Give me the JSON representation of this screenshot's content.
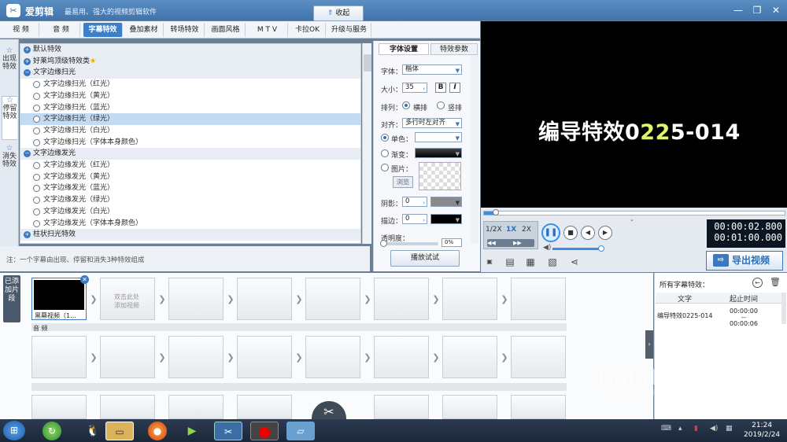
{
  "window": {
    "title": "爱剪辑",
    "slogan": "最易用、强大的视频剪辑软件",
    "logo_icon": "scissors-logo-icon"
  },
  "menu": {
    "tabs": [
      {
        "label": "视 频"
      },
      {
        "label": "音 频"
      },
      {
        "label": "字幕特效",
        "active": true
      },
      {
        "label": "叠加素材"
      },
      {
        "label": "转场特效"
      },
      {
        "label": "画面风格"
      },
      {
        "label": "M T V"
      },
      {
        "label": "卡拉OK"
      },
      {
        "label": "升级与服务"
      }
    ]
  },
  "side_tabs": [
    {
      "label": "出现特效"
    },
    {
      "label": "停留特效",
      "active": true
    },
    {
      "label": "消失特效"
    }
  ],
  "effect_list": [
    {
      "label": "默认特效",
      "type": "category"
    },
    {
      "label": "好莱坞顶级特效类",
      "type": "category",
      "star": "★"
    },
    {
      "label": "文字边缘扫光",
      "type": "category"
    },
    {
      "label": "文字边缘扫光（红光）",
      "type": "item"
    },
    {
      "label": "文字边缘扫光（黄光）",
      "type": "item"
    },
    {
      "label": "文字边缘扫光（蓝光）",
      "type": "item"
    },
    {
      "label": "文字边缘扫光（绿光）",
      "type": "item",
      "selected": true
    },
    {
      "label": "文字边缘扫光（白光）",
      "type": "item"
    },
    {
      "label": "文字边缘扫光（字体本身颜色）",
      "type": "item"
    },
    {
      "label": "文字边缘发光",
      "type": "category"
    },
    {
      "label": "文字边缘发光（红光）",
      "type": "item"
    },
    {
      "label": "文字边缘发光（黄光）",
      "type": "item"
    },
    {
      "label": "文字边缘发光（蓝光）",
      "type": "item"
    },
    {
      "label": "文字边缘发光（绿光）",
      "type": "item"
    },
    {
      "label": "文字边缘发光（白光）",
      "type": "item"
    },
    {
      "label": "文字边缘发光（字体本身颜色）",
      "type": "item"
    },
    {
      "label": "柱状扫光特效",
      "type": "category"
    }
  ],
  "note": {
    "text": "注：一个字幕由出现、停留和消失3种特效组成",
    "collapse_label": "收起"
  },
  "font_panel": {
    "tabs": [
      "字体设置",
      "特效参数"
    ],
    "font_label": "字体：",
    "font_value": "楷体",
    "size_label": "大小：",
    "size_value": "35",
    "bold": "B",
    "italic": "I",
    "layout_label": "排列：",
    "layout_h": "横排",
    "layout_v": "竖排",
    "align_label": "对齐：",
    "align_value": "多行时左对齐",
    "solid_label": "单色：",
    "gradient_label": "渐变：",
    "image_label": "图片：",
    "browse_label": "浏览",
    "shadow_label": "阴影：",
    "shadow_value": "0",
    "stroke_label": "描边：",
    "stroke_value": "0",
    "opacity_label": "透明度：",
    "opacity_value": "0%",
    "preview_button": "播放试试"
  },
  "preview": {
    "text_before": "编导特效0",
    "text_glow": "22",
    "text_after": "5-014"
  },
  "player": {
    "speeds": [
      "1/2X",
      "1X",
      "2X"
    ],
    "time_current": "00:00:02.800",
    "time_total": "00:01:00.000",
    "export_label": "导出视频"
  },
  "timeline": {
    "label": "已添加片段",
    "first_clip_caption": "黑幕视频（1...",
    "placeholder": "双击此处\n添加视频",
    "audio_label": "音 频"
  },
  "subtitles": {
    "title": "所有字幕特效：",
    "col_text": "文字",
    "col_time": "起止时间",
    "row_text": "编导特效0225-014",
    "row_start": "00:00:00",
    "row_sep": "--",
    "row_end": "00:00:06"
  },
  "taskbar": {
    "time": "21:24",
    "date": "2019/2/24"
  },
  "watermark": {
    "text": "Bai du 经验",
    "url": "jingyan.baidu.com"
  },
  "colors": {
    "accent": "#3c7fc7",
    "preview_glow": "#dff56f"
  }
}
